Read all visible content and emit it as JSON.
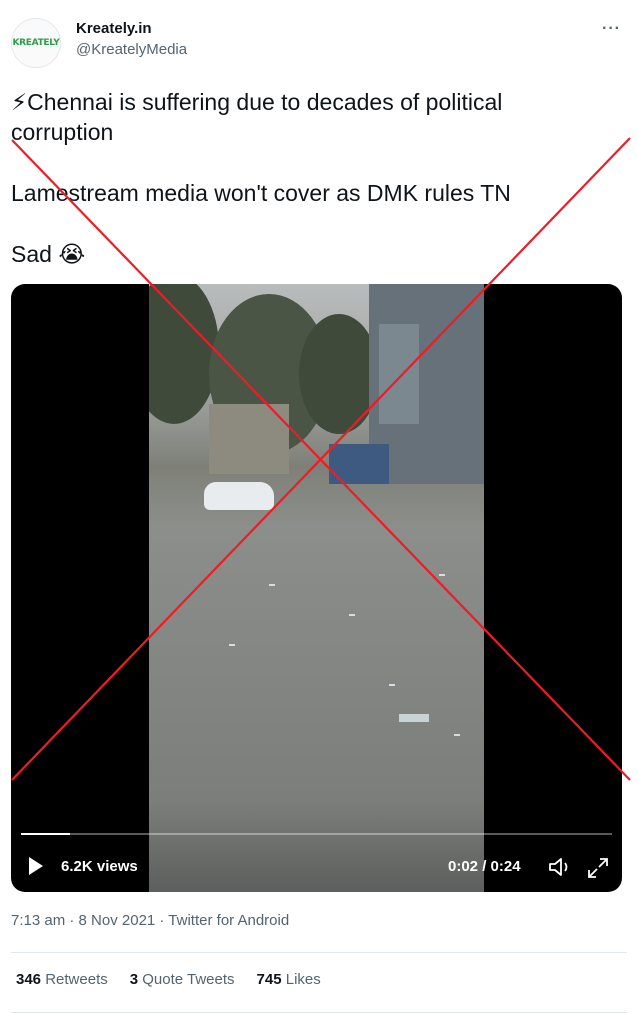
{
  "author": {
    "avatar_text": "KREATELY",
    "display_name": "Kreately.in",
    "handle": "@KreatelyMedia"
  },
  "tweet": {
    "line1": "⚡Chennai is suffering due to decades of political",
    "line2": "corruption",
    "line3": "Lamestream media won't cover as DMK rules TN",
    "line4": "Sad 😭"
  },
  "video": {
    "views": "6.2K views",
    "time": "0:02 / 0:24",
    "progress": 0.0833
  },
  "meta": "7:13 am · 8 Nov 2021 · Twitter for Android",
  "stats": {
    "retweets_count": "346",
    "retweets_label": "Retweets",
    "quotes_count": "3",
    "quotes_label": "Quote Tweets",
    "likes_count": "745",
    "likes_label": "Likes"
  },
  "colors": {
    "cross": "#ee1c25",
    "handle_gray": "#536471"
  },
  "icons": {
    "more": "more-icon",
    "play": "play-icon",
    "volume": "volume-icon",
    "fullscreen": "fullscreen-icon"
  }
}
